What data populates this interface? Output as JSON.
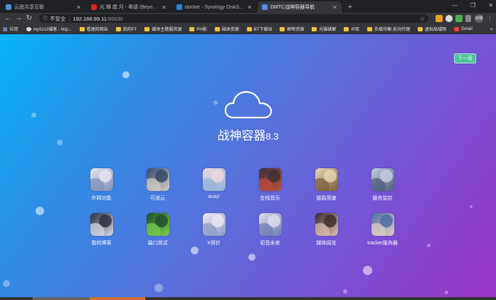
{
  "browser": {
    "tabs": [
      {
        "title": "云盘共享互联",
        "favicon_color": "#4a90d9",
        "active": false
      },
      {
        "title": "光 輝 歲 月 - 粵語 (Beyond)",
        "favicon_color": "#e62117",
        "active": false
      },
      {
        "title": "docker - Synology DiskStation",
        "favicon_color": "#1e88e5",
        "active": false
      },
      {
        "title": "DMTC战神容器导航",
        "favicon_color": "#5a8dee",
        "active": true
      }
    ],
    "url": {
      "security_label": "不安全",
      "host": "192.168.99.11",
      "port": ":65530"
    },
    "profile_label": "天翊",
    "bookmarks": [
      {
        "label": "应用",
        "icon": "apps-icon"
      },
      {
        "label": "mySz12媒客 - http...",
        "icon": "site-icon"
      },
      {
        "label": "看速的网站",
        "icon": "folder-icon"
      },
      {
        "label": "我的PT",
        "icon": "folder-icon"
      },
      {
        "label": "媒体主题服资源",
        "icon": "folder-icon"
      },
      {
        "label": "PH影",
        "icon": "folder-icon"
      },
      {
        "label": "磁体资源",
        "icon": "folder-icon"
      },
      {
        "label": "BT下载站",
        "icon": "folder-icon"
      },
      {
        "label": "群晖资源",
        "icon": "folder-icon"
      },
      {
        "label": "光猫破解",
        "icon": "folder-icon"
      },
      {
        "label": "IP库",
        "icon": "folder-icon"
      },
      {
        "label": "负载均衡-反向代理",
        "icon": "folder-icon"
      },
      {
        "label": "虚拟局域网",
        "icon": "folder-icon"
      },
      {
        "label": "Gmail",
        "icon": "gmail-icon"
      }
    ]
  },
  "page": {
    "next_button": "下一页",
    "title": "战神容器",
    "version": "8.3",
    "apps": [
      {
        "label": "外网功能",
        "c1": "#e8e6f0",
        "c2": "#7a8fb8"
      },
      {
        "label": "可道云",
        "c1": "#2e4668",
        "c2": "#d9d2c8"
      },
      {
        "label": "Aria2",
        "c1": "#f0d8e0",
        "c2": "#8fb0d8"
      },
      {
        "label": "在线音乐",
        "c1": "#3a2f3a",
        "c2": "#c0503a"
      },
      {
        "label": "链路测速",
        "c1": "#e8d8b0",
        "c2": "#7a5a3a"
      },
      {
        "label": "服务监控",
        "c1": "#c8d0e0",
        "c2": "#4a5a7a"
      },
      {
        "label": "我的博客",
        "c1": "#2a2a3a",
        "c2": "#d8dae8"
      },
      {
        "label": "端口测试",
        "c1": "#1f4a2a",
        "c2": "#7ad04a"
      },
      {
        "label": "X探针",
        "c1": "#f0e8f0",
        "c2": "#8a9ac8"
      },
      {
        "label": "初音未来",
        "c1": "#e0e0ec",
        "c2": "#6a7ab0"
      },
      {
        "label": "媒体阅览",
        "c1": "#3a2a2a",
        "c2": "#e0c0b0"
      },
      {
        "label": "tracker服务器",
        "c1": "#4a6aa0",
        "c2": "#e0d0c8"
      }
    ]
  }
}
